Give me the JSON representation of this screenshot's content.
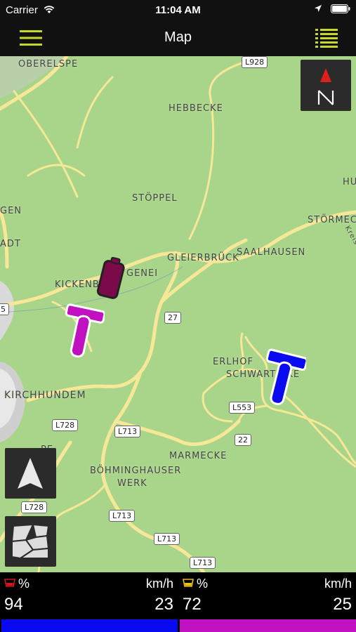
{
  "statusbar": {
    "carrier": "Carrier",
    "time": "11:04 AM"
  },
  "navbar": {
    "title": "Map"
  },
  "map": {
    "places": [
      {
        "id": "oberelspe",
        "label": "OBERELSPE"
      },
      {
        "id": "hebbecke",
        "label": "HEBBECKE"
      },
      {
        "id": "stoppel",
        "label": "STÖPPEL"
      },
      {
        "id": "gen",
        "label": "GEN"
      },
      {
        "id": "adt",
        "label": "ADT"
      },
      {
        "id": "stormeck",
        "label": "STÖRMECK"
      },
      {
        "id": "hu",
        "label": "HU"
      },
      {
        "id": "saalhausen",
        "label": "SAALHAUSEN"
      },
      {
        "id": "gleierbruck",
        "label": "GLEIERBRÜCK"
      },
      {
        "id": "genei",
        "label": "GENEI"
      },
      {
        "id": "kickenb",
        "label": "KICKENB"
      },
      {
        "id": "erlhof",
        "label": "ERLHOF"
      },
      {
        "id": "schwartecke",
        "label": "SCHWART   CKE"
      },
      {
        "id": "kirchhundem",
        "label": "KIRCHHUNDEM"
      },
      {
        "id": "pe",
        "label": "PE"
      },
      {
        "id": "marmecke",
        "label": "MARMECKE"
      },
      {
        "id": "bohm1",
        "label": "BÖHMINGHAUSER"
      },
      {
        "id": "bohm2",
        "label": "WERK"
      },
      {
        "id": "kreis",
        "label": "Kreis"
      }
    ],
    "roads": [
      {
        "id": "l928",
        "label": "L928"
      },
      {
        "id": "r27",
        "label": "27"
      },
      {
        "id": "l553",
        "label": "L553"
      },
      {
        "id": "r22",
        "label": "22"
      },
      {
        "id": "l728a",
        "label": "L728"
      },
      {
        "id": "l713a",
        "label": "L713"
      },
      {
        "id": "l728b",
        "label": "L728"
      },
      {
        "id": "l713b",
        "label": "L713"
      },
      {
        "id": "l713c",
        "label": "L713"
      },
      {
        "id": "l713d",
        "label": "L713"
      },
      {
        "id": "r5",
        "label": "5"
      }
    ]
  },
  "panels": [
    {
      "pct_label": "%",
      "unit": "km/h",
      "value": "94",
      "speed": "23",
      "bar_color": "#0a0af0",
      "icon_color": "#d01818"
    },
    {
      "pct_label": "%",
      "unit": "km/h",
      "value": "72",
      "speed": "25",
      "bar_color": "#c010c0",
      "icon_color": "#e8c21a"
    }
  ],
  "colors": {
    "accent": "#c6d82a",
    "map_bg": "#a9d58a",
    "road": "#f6e48a"
  }
}
